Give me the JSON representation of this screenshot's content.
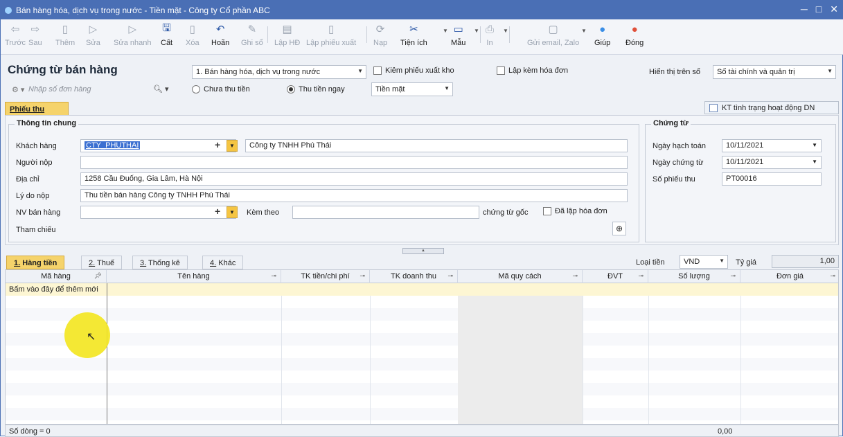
{
  "window": {
    "title": "Bán hàng hóa, dịch vụ trong nước - Tiền mặt - Công ty Cổ phần ABC",
    "minimize": "─",
    "maximize": "□",
    "close": "✕"
  },
  "toolbar": {
    "truoc": "Trước",
    "sau": "Sau",
    "them": "Thêm",
    "sua": "Sửa",
    "suanhanh": "Sửa nhanh",
    "cat": "Cất",
    "xoa": "Xóa",
    "hoan": "Hoãn",
    "ghiso": "Ghi sổ",
    "laphd": "Lập HĐ",
    "lapphieuxuat": "Lập phiếu xuất",
    "nap": "Nạp",
    "tienich": "Tiện ích",
    "mau": "Mẫu",
    "in": "In",
    "guiemail": "Gửi email, Zalo",
    "giup": "Giúp",
    "dong": "Đóng"
  },
  "header": {
    "title": "Chứng từ bán hàng",
    "type_select": "1. Bán hàng hóa, dịch vụ trong nước",
    "kiem_phieu_xuat": "Kiêm phiếu xuất kho",
    "lap_kem_hoa_don": "Lập kèm hóa đơn",
    "hien_thi_label": "Hiển thị trên sổ",
    "hien_thi_value": "Sổ tài chính và quản trị",
    "search_placeholder": "Nhập số đơn hàng",
    "chua_thu": "Chưa thu tiền",
    "thu_ngay": "Thu tiền ngay",
    "payment_method": "Tiền mặt"
  },
  "tab_phieu_thu": "Phiếu thu",
  "kt_button": "KT tình trạng hoạt động DN",
  "general": {
    "legend": "Thông tin chung",
    "khach_hang_label": "Khách hàng",
    "khach_hang_code": "CTY_PHUTHAI",
    "khach_hang_name": "Công ty TNHH Phú Thái",
    "nguoi_nop_label": "Người nộp",
    "nguoi_nop": "",
    "dia_chi_label": "Địa chỉ",
    "dia_chi": "1258 Cầu Đuống, Gia Lâm, Hà Nội",
    "ly_do_label": "Lý do nộp",
    "ly_do": "Thu tiền bán hàng Công ty TNHH Phú Thái",
    "nv_label": "NV bán hàng",
    "kem_theo_label": "Kèm theo",
    "chung_tu_goc": "chứng từ gốc",
    "da_lap_hoa_don": "Đã lập hóa đơn",
    "tham_chieu_label": "Tham chiếu"
  },
  "voucher": {
    "legend": "Chứng từ",
    "ngay_hach_toan_label": "Ngày hạch toán",
    "ngay_hach_toan": "10/11/2021",
    "ngay_chung_tu_label": "Ngày chứng từ",
    "ngay_chung_tu": "10/11/2021",
    "so_phieu_thu_label": "Số phiếu thu",
    "so_phieu_thu": "PT00016"
  },
  "grid_tabs": {
    "hang_tien": "Hàng tiền",
    "thue": "Thuế",
    "thong_ke": "Thống kê",
    "khac": "Khác",
    "n1": "1.",
    "n2": "2.",
    "n3": "3.",
    "n4": "4."
  },
  "currency": {
    "loai_tien_label": "Loại tiền",
    "loai_tien": "VND",
    "ty_gia_label": "Tỷ giá",
    "ty_gia": "1,00"
  },
  "grid": {
    "columns": [
      "Mã hàng",
      "Tên hàng",
      "TK tiền/chi phí",
      "TK doanh thu",
      "Mã quy cách",
      "ĐVT",
      "Số lượng",
      "Đơn giá"
    ],
    "add_row": "Bấm vào đây để thêm mới"
  },
  "footer": {
    "so_dong": "Số dòng = 0",
    "total": "0,00"
  }
}
